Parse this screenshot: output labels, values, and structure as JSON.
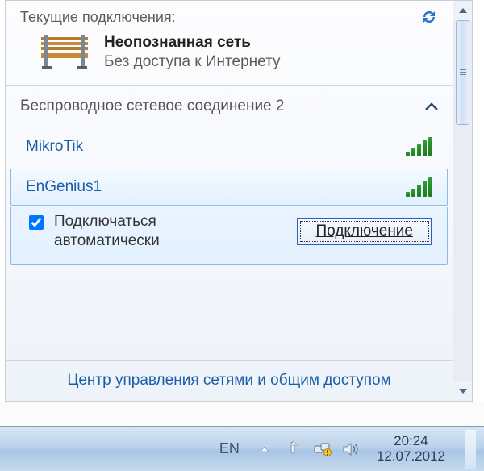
{
  "header": {
    "title": "Текущие подключения:"
  },
  "current": {
    "title": "Неопознанная сеть",
    "subtitle": "Без доступа к Интернету"
  },
  "section": {
    "title": "Беспроводное сетевое соединение 2"
  },
  "networks": [
    {
      "name": "MikroTik",
      "selected": false
    },
    {
      "name": "EnGenius1",
      "selected": true
    }
  ],
  "auto_connect": {
    "checked": true,
    "label": "Подключаться автоматически"
  },
  "connect_button": "Подключение",
  "footer_link": "Центр управления сетями и общим доступом",
  "tray": {
    "lang": "EN",
    "time": "20:24",
    "date": "12.07.2012"
  }
}
